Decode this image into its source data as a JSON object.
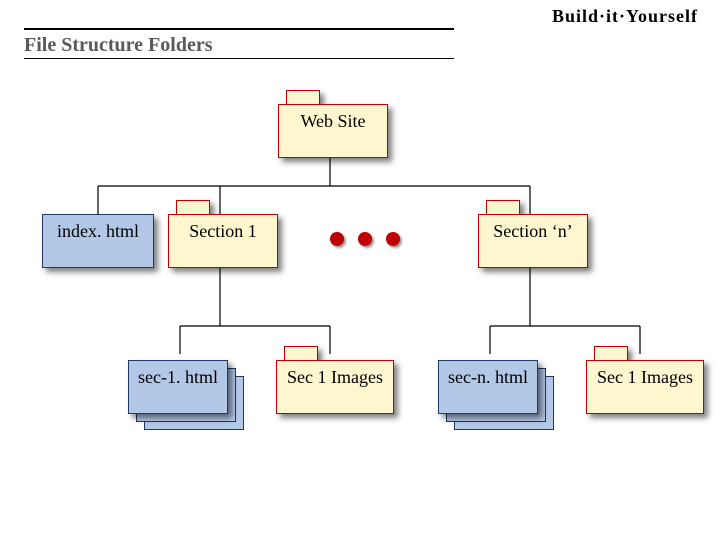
{
  "header": {
    "title": "File Structure Folders",
    "logo_text": "Build·it·Yourself"
  },
  "nodes": {
    "root": "Web Site",
    "index": "index. html",
    "section1": "Section 1",
    "sectionN": "Section ‘n’",
    "sec1html": "sec-1. html",
    "sec1images": "Sec 1 Images",
    "secnhtml": "sec-n. html",
    "secnimages": "Sec 1 Images"
  }
}
